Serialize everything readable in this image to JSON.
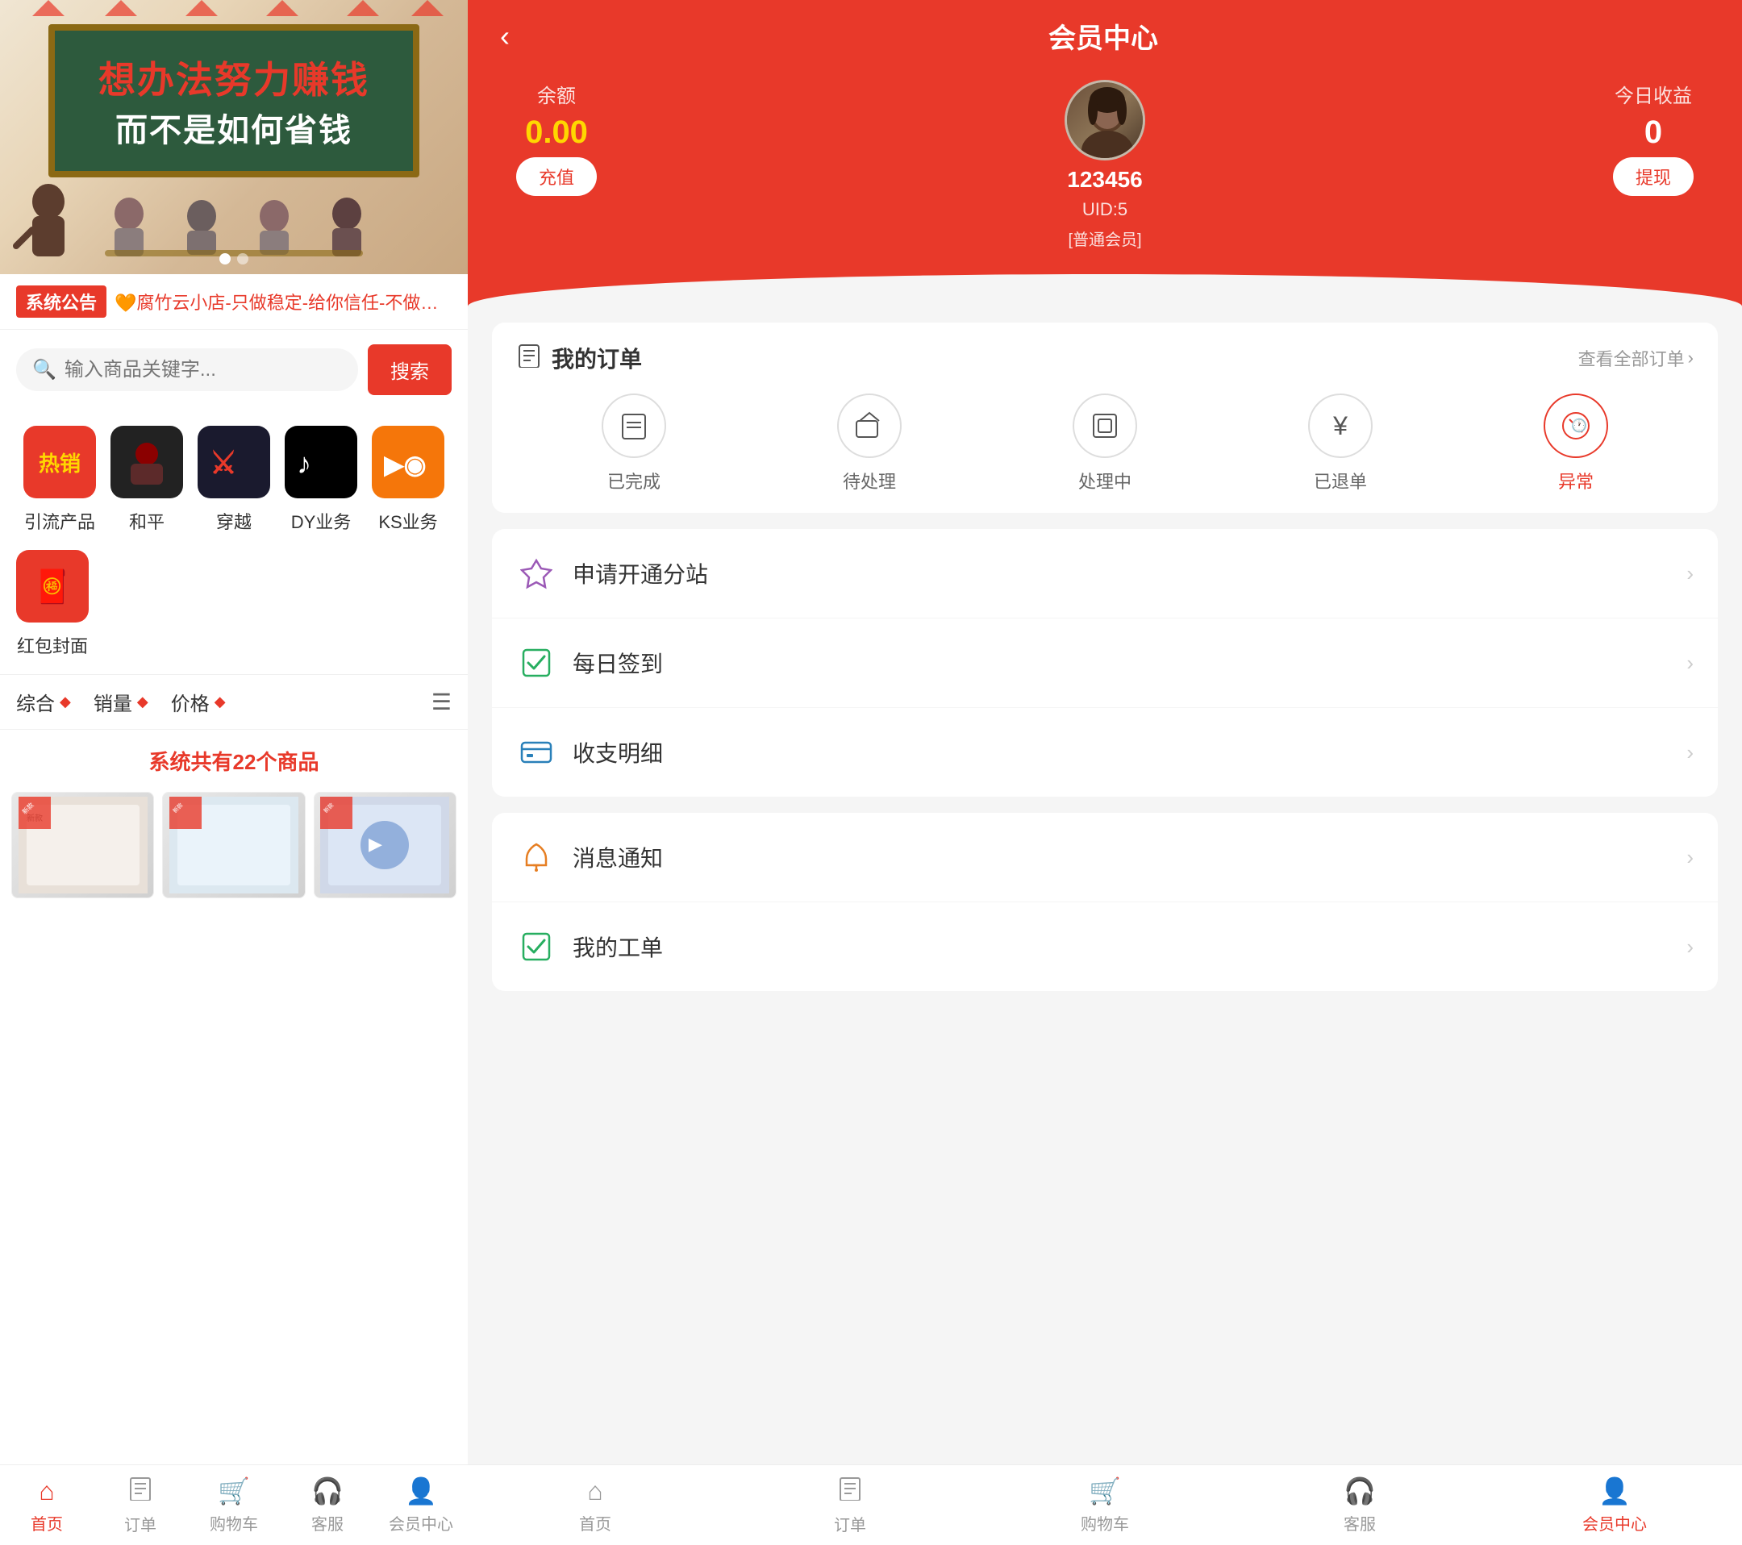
{
  "left": {
    "banner": {
      "text1": "想办法努力赚钱",
      "text2": "而不是如何省钱"
    },
    "notice": {
      "label": "系统公告",
      "text": "🧡腐竹云小店-只做稳定-给你信任-不做跑路狗-售后稳定🧡"
    },
    "search": {
      "placeholder": "输入商品关键字...",
      "button": "搜索"
    },
    "categories": [
      {
        "label": "引流产品",
        "color": "#e8392a",
        "text": "热销"
      },
      {
        "label": "和平",
        "color": "#222",
        "text": "🎮"
      },
      {
        "label": "穿越",
        "color": "#1a1a2e",
        "text": "🎯"
      },
      {
        "label": "DY业务",
        "color": "#000",
        "text": "♪"
      },
      {
        "label": "KS业务",
        "color": "#f5760a",
        "text": "📹"
      }
    ],
    "extra_category": {
      "label": "红包封面",
      "color": "#e8392a",
      "icon": "🧧"
    },
    "sort": {
      "items": [
        "综合",
        "销量",
        "价格"
      ],
      "diamond": "◆"
    },
    "products_count": "系统共有22个商品",
    "bottom_nav": [
      {
        "icon": "⌂",
        "label": "首页",
        "active": true
      },
      {
        "icon": "📋",
        "label": "订单",
        "active": false
      },
      {
        "icon": "🛒",
        "label": "购物车",
        "active": false
      },
      {
        "icon": "🎧",
        "label": "客服",
        "active": false
      },
      {
        "icon": "👤",
        "label": "会员中心",
        "active": false
      }
    ]
  },
  "right": {
    "header": {
      "back": "‹",
      "title": "会员中心",
      "balance_label": "余额",
      "balance_value": "0.00",
      "recharge_btn": "充值",
      "username": "123456",
      "uid": "UID:5",
      "member_type": "[普通会员]",
      "earnings_label": "今日收益",
      "earnings_value": "0",
      "withdraw_btn": "提现"
    },
    "orders": {
      "title": "我的订单",
      "view_all": "查看全部订单",
      "items": [
        {
          "icon": "💳",
          "label": "已完成",
          "is_red": false
        },
        {
          "icon": "🚚",
          "label": "待处理",
          "is_red": false
        },
        {
          "icon": "⬜",
          "label": "处理中",
          "is_red": false
        },
        {
          "icon": "¥",
          "label": "已退单",
          "is_red": false
        },
        {
          "icon": "🕐",
          "label": "异常",
          "is_red": true
        }
      ]
    },
    "menu_items": [
      {
        "icon": "💎",
        "label": "申请开通分站",
        "color": "#9B59B6"
      },
      {
        "icon": "✅",
        "label": "每日签到",
        "color": "#27AE60"
      },
      {
        "icon": "💳",
        "label": "收支明细",
        "color": "#2980B9"
      },
      {
        "icon": "🔔",
        "label": "消息通知",
        "color": "#E67E22"
      },
      {
        "icon": "✅",
        "label": "我的工单",
        "color": "#27AE60"
      }
    ],
    "bottom_nav": [
      {
        "icon": "⌂",
        "label": "首页",
        "active": false
      },
      {
        "icon": "📋",
        "label": "订单",
        "active": false
      },
      {
        "icon": "🛒",
        "label": "购物车",
        "active": false
      },
      {
        "icon": "🎧",
        "label": "客服",
        "active": false
      },
      {
        "icon": "👤",
        "label": "会员中心",
        "active": true
      }
    ]
  }
}
